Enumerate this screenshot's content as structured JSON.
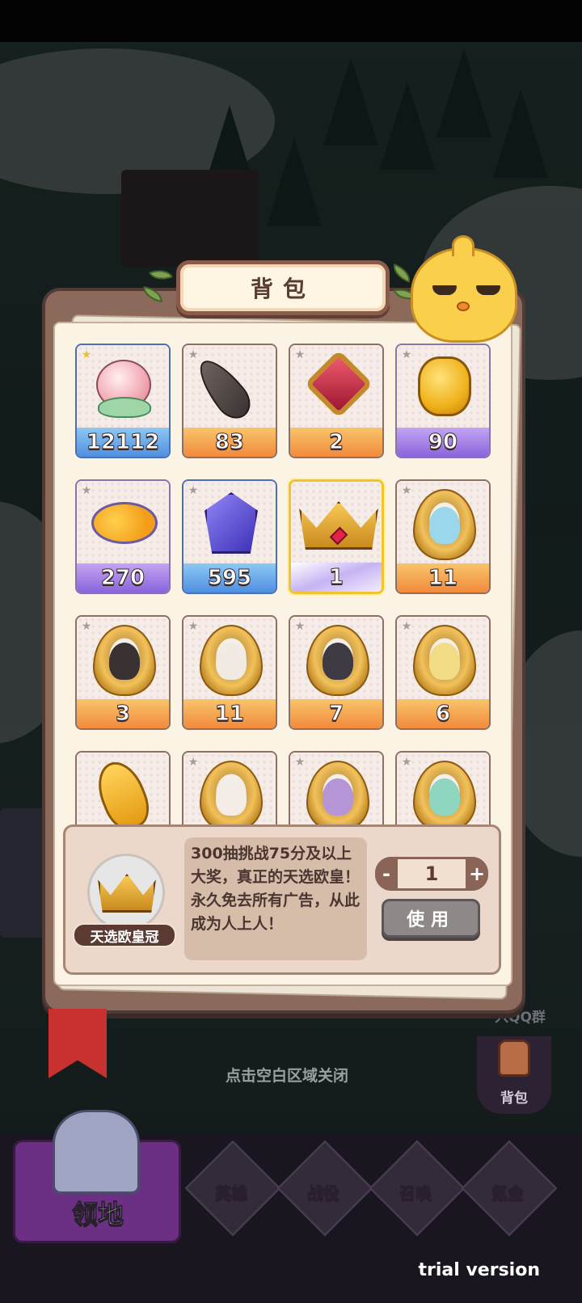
{
  "panel": {
    "title": "背包"
  },
  "items": [
    {
      "count": "12112",
      "bar": "blue",
      "border": "blue",
      "art": "onion",
      "star": "gold"
    },
    {
      "count": "83",
      "bar": "orange",
      "border": "brown",
      "art": "feather",
      "star": "grey"
    },
    {
      "count": "2",
      "bar": "orange",
      "border": "brown",
      "art": "gem",
      "star": "grey"
    },
    {
      "count": "90",
      "bar": "purple",
      "border": "purple",
      "art": "coin",
      "star": "grey"
    },
    {
      "count": "270",
      "bar": "purple",
      "border": "purple",
      "art": "candy",
      "star": "grey"
    },
    {
      "count": "595",
      "bar": "blue",
      "border": "blue",
      "art": "crystal",
      "star": "grey"
    },
    {
      "count": "1",
      "bar": "lilac",
      "border": "selected",
      "art": "crown",
      "star": "none"
    },
    {
      "count": "11",
      "bar": "orange",
      "border": "brown",
      "art": "frame",
      "portrait_color": "#9bd6ea",
      "star": "grey"
    },
    {
      "count": "3",
      "bar": "orange",
      "border": "brown",
      "art": "frame",
      "portrait_color": "#3a3232",
      "star": "grey"
    },
    {
      "count": "11",
      "bar": "orange",
      "border": "brown",
      "art": "frame",
      "portrait_color": "#f1ebe4",
      "star": "grey"
    },
    {
      "count": "7",
      "bar": "orange",
      "border": "brown",
      "art": "frame",
      "portrait_color": "#3d3a44",
      "star": "grey"
    },
    {
      "count": "6",
      "bar": "orange",
      "border": "brown",
      "art": "frame",
      "portrait_color": "#f3dc86",
      "star": "grey"
    },
    {
      "count": "",
      "bar": "orange",
      "border": "brown",
      "art": "tome",
      "star": "none"
    },
    {
      "count": "",
      "bar": "orange",
      "border": "brown",
      "art": "frame",
      "portrait_color": "#f4ece6",
      "star": "grey"
    },
    {
      "count": "",
      "bar": "orange",
      "border": "brown",
      "art": "frame",
      "portrait_color": "#b695d6",
      "star": "grey"
    },
    {
      "count": "",
      "bar": "orange",
      "border": "brown",
      "art": "frame",
      "portrait_color": "#8fd6c0",
      "star": "grey"
    }
  ],
  "detail": {
    "name": "天选欧皇冠",
    "description": "300抽挑战75分及以上大奖，真正的天选欧皇！永久免去所有广告，从此成为人上人！",
    "quantity": "1",
    "minus": "-",
    "plus": "+",
    "use_label": "使用"
  },
  "close_hint": "点击空白区域关闭",
  "side": {
    "qq_label": "入QQ群",
    "bag_label": "背包"
  },
  "nav": {
    "home": "领地",
    "heroes": "英雄",
    "battle": "战役",
    "summon": "召唤",
    "shop": "氪金"
  },
  "watermark": "trial version",
  "colors": {
    "accent_gold": "#f2c231",
    "panel_brown": "#8b6a5c",
    "paper": "#fbf3e4"
  }
}
